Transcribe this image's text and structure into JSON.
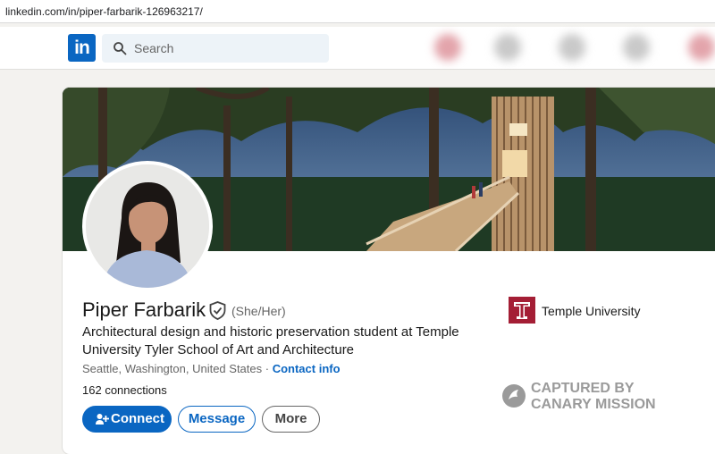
{
  "browser": {
    "url": "linkedin.com/in/piper-farbarik-126963217/"
  },
  "nav": {
    "logo_text": "in",
    "search_placeholder": "Search"
  },
  "profile": {
    "name": "Piper Farbarik",
    "pronouns": "(She/Her)",
    "headline": "Architectural design and historic preservation student at Temple University Tyler School of Art and Architecture",
    "location": "Seattle, Washington, United States",
    "separator": " · ",
    "contact_info": "Contact info",
    "connections_count": "162",
    "connections_label": " connections",
    "education": "Temple University"
  },
  "actions": {
    "connect": "Connect",
    "message": "Message",
    "more": "More"
  },
  "watermark": {
    "line1": "CAPTURED BY",
    "line2": "CANARY MISSION"
  },
  "colors": {
    "brand": "#0a66c2",
    "temple": "#a41e35",
    "page_bg": "#f3f2ef"
  }
}
